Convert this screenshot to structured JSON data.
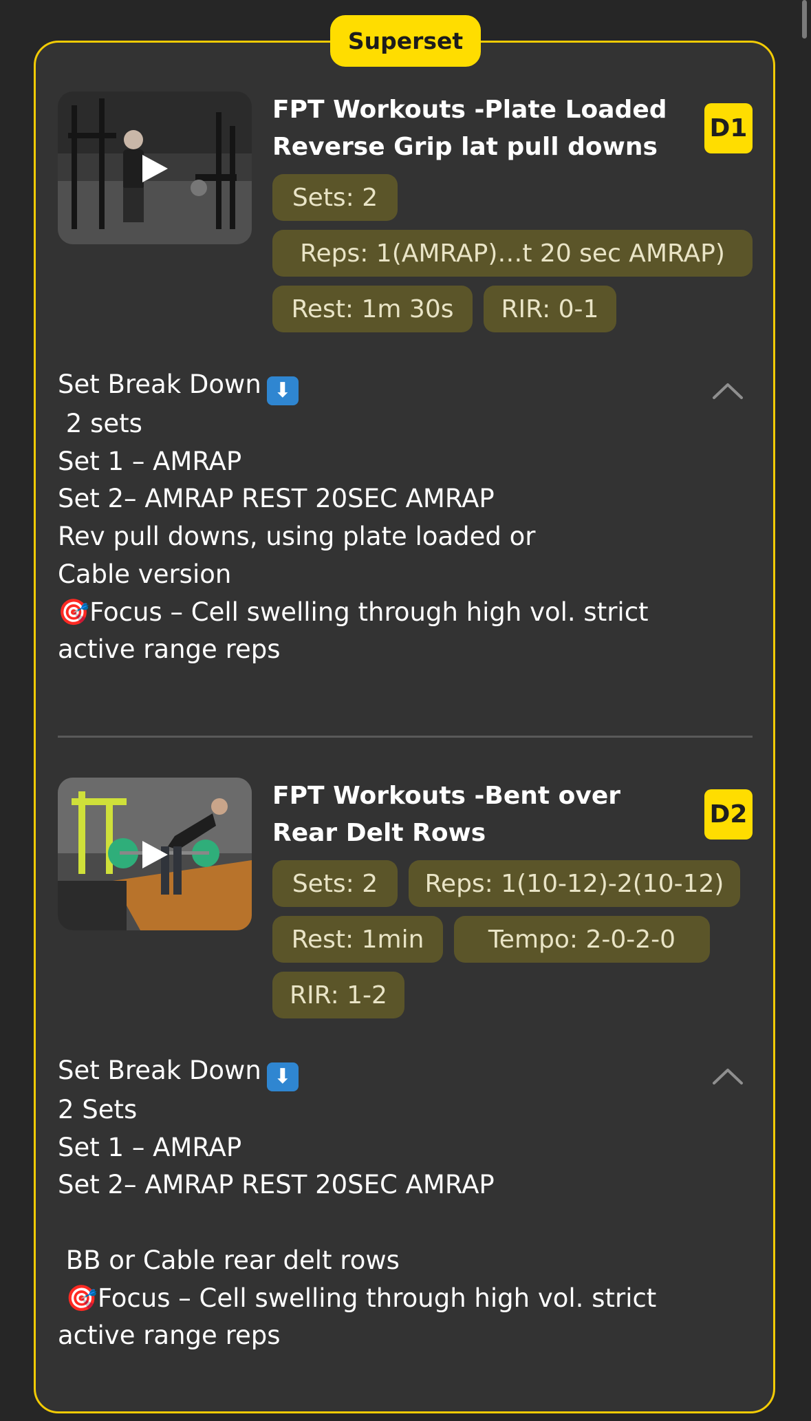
{
  "superset_label": "Superset",
  "exercises": [
    {
      "title": "FPT Workouts -Plate Loaded Reverse Grip lat pull downs",
      "code": "D1",
      "chips": {
        "sets": "Sets: 2",
        "reps": "Reps: 1(AMRAP)…t 20 sec AMRAP)",
        "rest": "Rest: 1m 30s",
        "rir": "RIR: 0-1"
      },
      "breakdown": {
        "heading": "Set Break Down",
        "lines": [
          " 2 sets",
          "Set 1 – AMRAP",
          "Set 2– AMRAP REST 20SEC AMRAP",
          "Rev pull downs, using plate loaded or",
          "Cable version",
          "🎯Focus – Cell swelling through high vol. strict",
          "active range reps"
        ]
      }
    },
    {
      "title": "FPT Workouts -Bent over Rear Delt Rows",
      "code": "D2",
      "chips": {
        "sets": "Sets: 2",
        "reps": "Reps: 1(10-12)-2(10-12)",
        "rest": "Rest: 1min",
        "tempo": "Tempo: 2-0-2-0",
        "rir": "RIR: 1-2"
      },
      "breakdown": {
        "heading": "Set Break Down",
        "lines": [
          "2 Sets",
          "Set 1 – AMRAP",
          "Set 2– AMRAP REST 20SEC AMRAP",
          "",
          " BB or Cable rear delt rows",
          " 🎯Focus – Cell swelling through high vol. strict",
          "active range reps"
        ]
      }
    }
  ],
  "icons": {
    "play": "play-icon",
    "down_arrow": "down-arrow-emoji-icon",
    "collapse": "chevron-up-icon"
  },
  "colors": {
    "accent_yellow": "#ffdd00",
    "chip_bg": "#5b5529",
    "card_bg": "#333333",
    "page_bg": "#262626"
  }
}
